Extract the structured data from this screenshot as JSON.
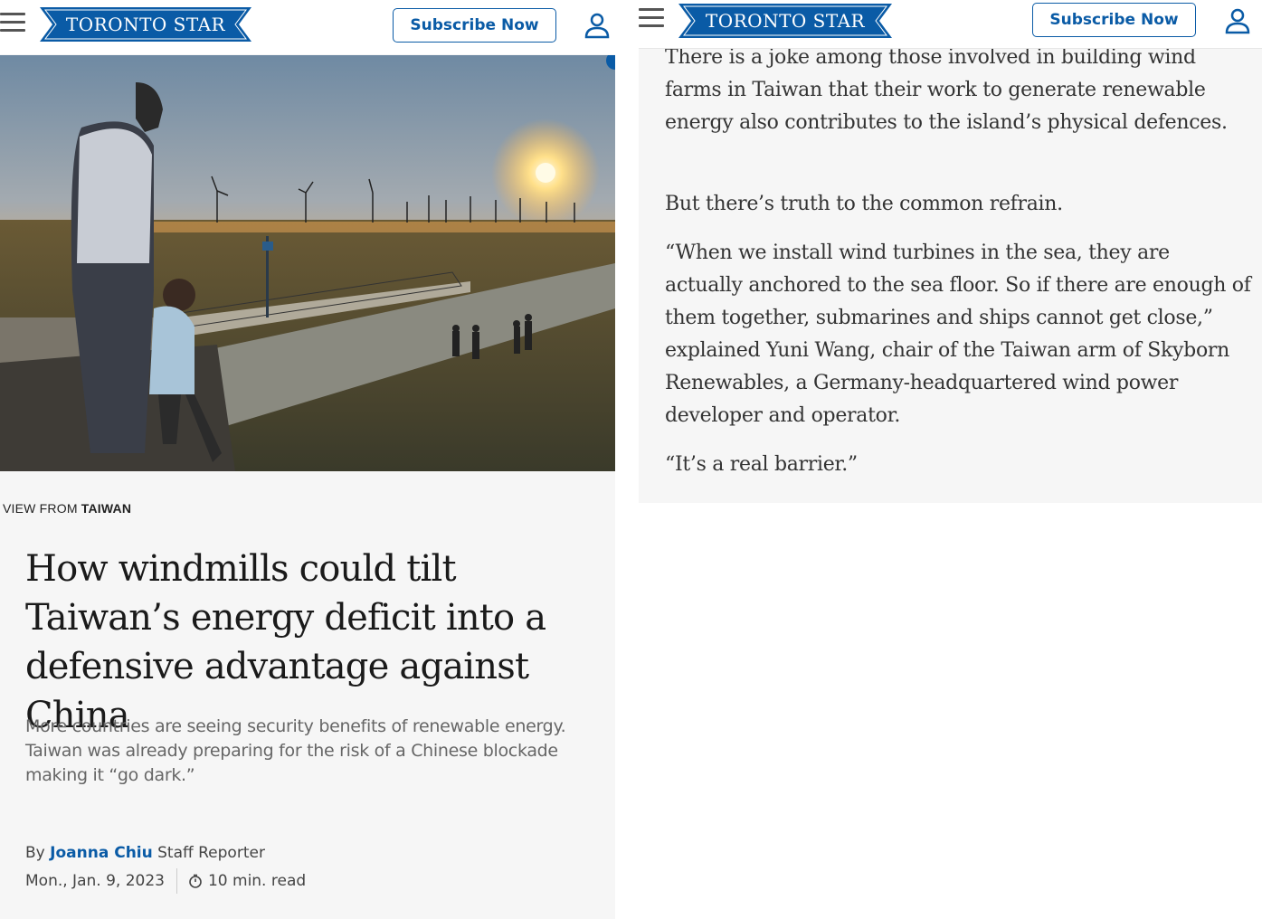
{
  "header": {
    "logo_text": "TORONTO STAR",
    "subscribe_label": "Subscribe Now",
    "brand_color": "#0a5ba6"
  },
  "hero_image": {
    "description_icon": "photo-sunset-wind-turbines"
  },
  "article_header": {
    "kicker_prefix": "VIEW FROM",
    "kicker_section": "TAIWAN",
    "headline": "How windmills could tilt Taiwan’s energy deficit into a defensive advantage against China",
    "dek": "More countries are seeing security benefits of renewable energy. Taiwan was already preparing for the risk of a Chinese blockade making it “go dark.”",
    "byline_prefix": "By",
    "author": "Joanna Chiu",
    "author_role": "Staff Reporter",
    "date": "Mon., Jan. 9, 2023",
    "read_time": "10 min. read"
  },
  "article_body": {
    "paragraphs": [
      "There is a joke among those involved in building wind farms in Taiwan that their work to generate renewable energy also contributes to the island’s physical defences.",
      "But there’s truth to the common refrain.",
      "“When we install wind turbines in the sea, they are actually anchored to the sea floor. So if there are enough of them together, submarines and ships cannot get close,” explained Yuni Wang, chair of the Taiwan arm of Skyborn Renewables, a Germany-headquartered wind power developer and operator.",
      "“It’s a real barrier.”"
    ]
  }
}
